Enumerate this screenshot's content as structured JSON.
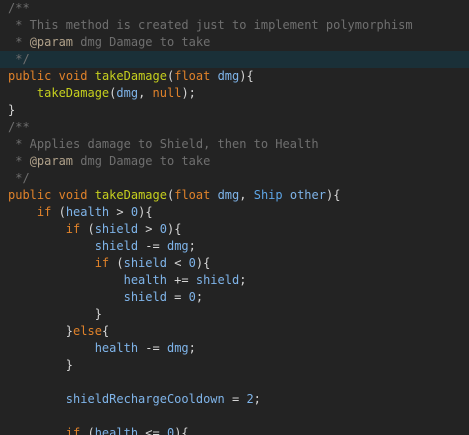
{
  "editor": {
    "lines": [
      {
        "indent": "",
        "tokens": [
          {
            "t": "/**",
            "c": "comment"
          }
        ]
      },
      {
        "indent": "",
        "tokens": [
          {
            "t": " * This method is created just to implement polymorphism",
            "c": "comment"
          }
        ]
      },
      {
        "indent": "",
        "tokens": [
          {
            "t": " * ",
            "c": "comment"
          },
          {
            "t": "@param",
            "c": "tag"
          },
          {
            "t": " dmg Damage to take",
            "c": "comment"
          }
        ]
      },
      {
        "indent": "",
        "highlight": true,
        "tokens": [
          {
            "t": " */",
            "c": "comment"
          }
        ]
      },
      {
        "indent": "",
        "tokens": [
          {
            "t": "public",
            "c": "kw"
          },
          {
            "t": " ",
            "c": "default"
          },
          {
            "t": "void",
            "c": "kw"
          },
          {
            "t": " ",
            "c": "default"
          },
          {
            "t": "takeDamage",
            "c": "fn"
          },
          {
            "t": "(",
            "c": "default"
          },
          {
            "t": "float",
            "c": "kw"
          },
          {
            "t": " ",
            "c": "default"
          },
          {
            "t": "dmg",
            "c": "var"
          },
          {
            "t": "){",
            "c": "default"
          }
        ]
      },
      {
        "indent": "    ",
        "tokens": [
          {
            "t": "takeDamage",
            "c": "fn"
          },
          {
            "t": "(",
            "c": "default"
          },
          {
            "t": "dmg",
            "c": "var"
          },
          {
            "t": ", ",
            "c": "default"
          },
          {
            "t": "null",
            "c": "null"
          },
          {
            "t": ");",
            "c": "default"
          }
        ]
      },
      {
        "indent": "",
        "tokens": [
          {
            "t": "}",
            "c": "default"
          }
        ]
      },
      {
        "indent": "",
        "tokens": [
          {
            "t": "/**",
            "c": "comment"
          }
        ]
      },
      {
        "indent": "",
        "tokens": [
          {
            "t": " * Applies damage to Shield, then to Health",
            "c": "comment"
          }
        ]
      },
      {
        "indent": "",
        "tokens": [
          {
            "t": " * ",
            "c": "comment"
          },
          {
            "t": "@param",
            "c": "tag"
          },
          {
            "t": " dmg Damage to take",
            "c": "comment"
          }
        ]
      },
      {
        "indent": "",
        "tokens": [
          {
            "t": " */",
            "c": "comment"
          }
        ]
      },
      {
        "indent": "",
        "tokens": [
          {
            "t": "public",
            "c": "kw"
          },
          {
            "t": " ",
            "c": "default"
          },
          {
            "t": "void",
            "c": "kw"
          },
          {
            "t": " ",
            "c": "default"
          },
          {
            "t": "takeDamage",
            "c": "fn"
          },
          {
            "t": "(",
            "c": "default"
          },
          {
            "t": "float",
            "c": "kw"
          },
          {
            "t": " ",
            "c": "default"
          },
          {
            "t": "dmg",
            "c": "var"
          },
          {
            "t": ", ",
            "c": "default"
          },
          {
            "t": "Ship",
            "c": "type"
          },
          {
            "t": " ",
            "c": "default"
          },
          {
            "t": "other",
            "c": "var"
          },
          {
            "t": "){",
            "c": "default"
          }
        ]
      },
      {
        "indent": "    ",
        "tokens": [
          {
            "t": "if",
            "c": "kw"
          },
          {
            "t": " (",
            "c": "default"
          },
          {
            "t": "health",
            "c": "var"
          },
          {
            "t": " > ",
            "c": "default"
          },
          {
            "t": "0",
            "c": "num"
          },
          {
            "t": "){",
            "c": "default"
          }
        ]
      },
      {
        "indent": "        ",
        "tokens": [
          {
            "t": "if",
            "c": "kw"
          },
          {
            "t": " (",
            "c": "default"
          },
          {
            "t": "shield",
            "c": "var"
          },
          {
            "t": " > ",
            "c": "default"
          },
          {
            "t": "0",
            "c": "num"
          },
          {
            "t": "){",
            "c": "default"
          }
        ]
      },
      {
        "indent": "            ",
        "tokens": [
          {
            "t": "shield",
            "c": "var"
          },
          {
            "t": " -= ",
            "c": "default"
          },
          {
            "t": "dmg",
            "c": "var"
          },
          {
            "t": ";",
            "c": "default"
          }
        ]
      },
      {
        "indent": "            ",
        "tokens": [
          {
            "t": "if",
            "c": "kw"
          },
          {
            "t": " (",
            "c": "default"
          },
          {
            "t": "shield",
            "c": "var"
          },
          {
            "t": " < ",
            "c": "default"
          },
          {
            "t": "0",
            "c": "num"
          },
          {
            "t": "){",
            "c": "default"
          }
        ]
      },
      {
        "indent": "                ",
        "tokens": [
          {
            "t": "health",
            "c": "var"
          },
          {
            "t": " += ",
            "c": "default"
          },
          {
            "t": "shield",
            "c": "var"
          },
          {
            "t": ";",
            "c": "default"
          }
        ]
      },
      {
        "indent": "                ",
        "tokens": [
          {
            "t": "shield",
            "c": "var"
          },
          {
            "t": " = ",
            "c": "default"
          },
          {
            "t": "0",
            "c": "num"
          },
          {
            "t": ";",
            "c": "default"
          }
        ]
      },
      {
        "indent": "            ",
        "tokens": [
          {
            "t": "}",
            "c": "default"
          }
        ]
      },
      {
        "indent": "        ",
        "tokens": [
          {
            "t": "}",
            "c": "default"
          },
          {
            "t": "else",
            "c": "kw"
          },
          {
            "t": "{",
            "c": "default"
          }
        ]
      },
      {
        "indent": "            ",
        "tokens": [
          {
            "t": "health",
            "c": "var"
          },
          {
            "t": " -= ",
            "c": "default"
          },
          {
            "t": "dmg",
            "c": "var"
          },
          {
            "t": ";",
            "c": "default"
          }
        ]
      },
      {
        "indent": "        ",
        "tokens": [
          {
            "t": "}",
            "c": "default"
          }
        ]
      },
      {
        "indent": "",
        "tokens": [
          {
            "t": "",
            "c": "default"
          }
        ]
      },
      {
        "indent": "        ",
        "tokens": [
          {
            "t": "shieldRechargeCooldown",
            "c": "var"
          },
          {
            "t": " = ",
            "c": "default"
          },
          {
            "t": "2",
            "c": "num"
          },
          {
            "t": ";",
            "c": "default"
          }
        ]
      },
      {
        "indent": "",
        "tokens": [
          {
            "t": "",
            "c": "default"
          }
        ]
      },
      {
        "indent": "        ",
        "tokens": [
          {
            "t": "if",
            "c": "kw"
          },
          {
            "t": " (",
            "c": "default"
          },
          {
            "t": "health",
            "c": "var"
          },
          {
            "t": " <= ",
            "c": "default"
          },
          {
            "t": "0",
            "c": "num"
          },
          {
            "t": "){",
            "c": "default"
          }
        ]
      }
    ]
  }
}
